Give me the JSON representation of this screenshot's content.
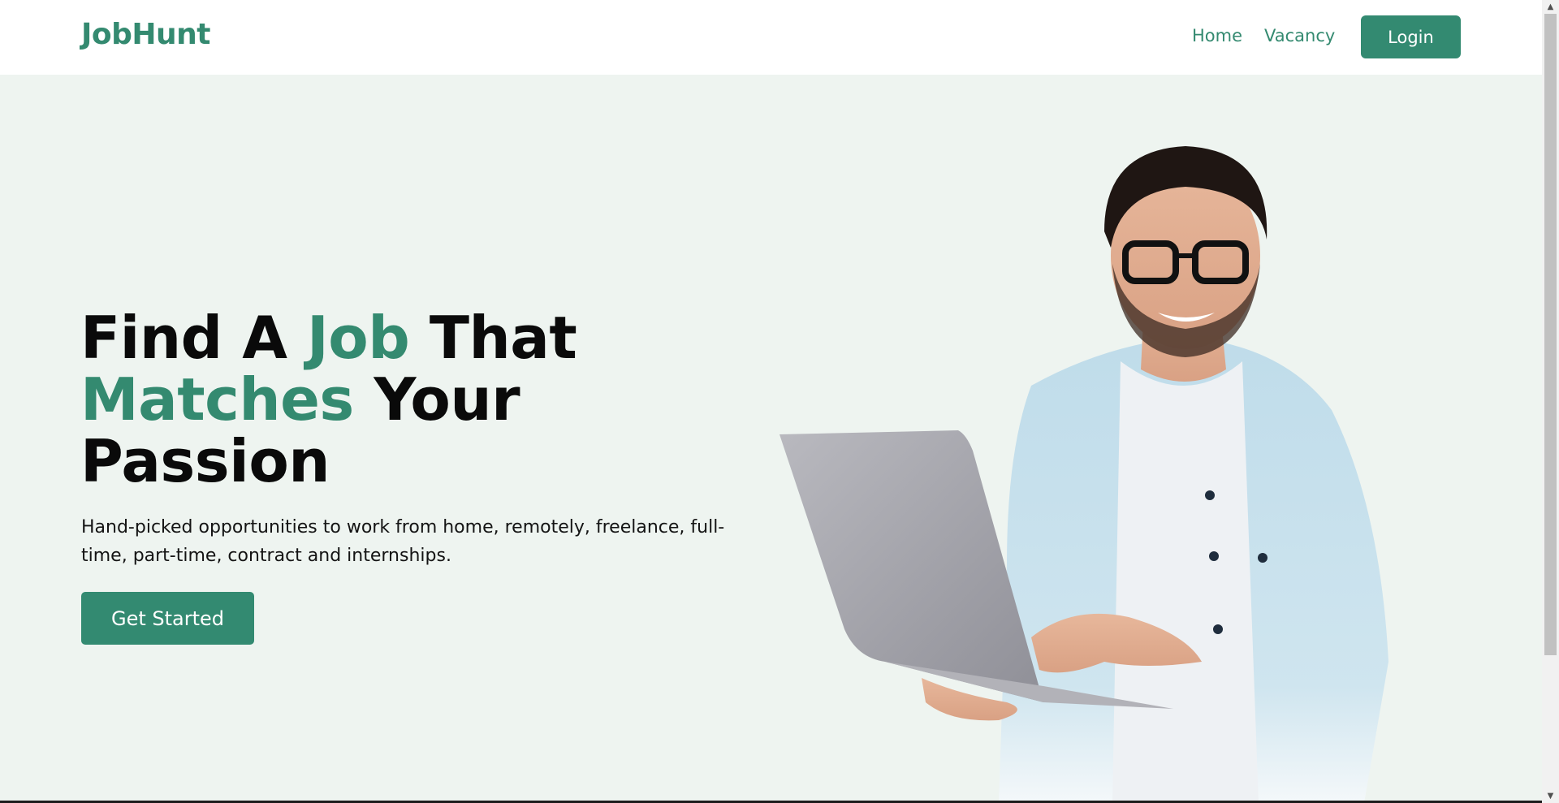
{
  "brand": {
    "name": "JobHunt"
  },
  "nav": {
    "links": [
      "Home",
      "Vacancy"
    ],
    "login_label": "Login"
  },
  "hero": {
    "title_parts": [
      "Find A ",
      "Job",
      " That ",
      "Matches",
      " Your Passion"
    ],
    "subtitle": "Hand-picked opportunities to work from home, remotely, freelance, full-time, part-time, contract and internships.",
    "cta_label": "Get Started",
    "image_subject": "man-with-laptop-icon"
  },
  "colors": {
    "accent": "#348a70",
    "button": "#338a71",
    "hero_background": "#eef4f0",
    "header_background": "#ffffff",
    "title_text": "#0a0a0a"
  }
}
